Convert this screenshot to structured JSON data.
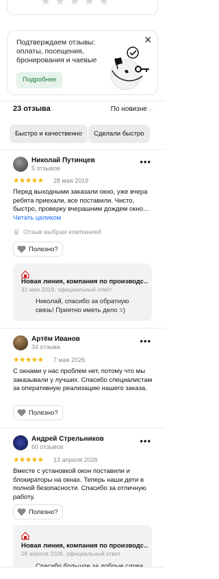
{
  "rating_filter": {
    "stars": [
      "★",
      "★",
      "★",
      "★",
      "★"
    ]
  },
  "promo": {
    "text": "Подтверждаем отзывы: оплаты, посещения, бронирования и чаевые",
    "button_label": "Подробнее",
    "close_icon": "✕"
  },
  "summary": {
    "count_label": "23 отзыва",
    "sort_label": "По новизне",
    "sort_arrow": "⌵"
  },
  "chips": [
    "Быстро и качественно",
    "Сделали быстро"
  ],
  "reviews": [
    {
      "author": "Николай Путинцев",
      "author_reviews": "5 отзывов",
      "stars": "★★★★★",
      "date": "28 мая 2019",
      "text": "Перед выходными заказали окно, уже вчера ребята приехали, все поставили. Чисто, быстро, проверку вчерашним дождем окно…",
      "read_more": "Читать целиком",
      "picked_label": "Отзыв выбран компанией",
      "useful_label": "Полезно?",
      "reply": {
        "company": "Новая линия, компания по производс…",
        "meta": "31 мая 2019, официальный ответ",
        "text": "Николай, спасибо за обратную связь! Приятно иметь дело =)"
      }
    },
    {
      "author": "Артём Иванов",
      "author_reviews": "34 отзыва",
      "stars": "★★★★★",
      "date": "7 мая 2026",
      "text": "С окнами у нас проблем нет, потому что мы заказывали у лучших. Спасибо специалистам за оперативную реализацию нашего заказа.",
      "useful_label": "Полезно?"
    },
    {
      "author": "Андрей Стрельников",
      "author_reviews": "60 отзывов",
      "stars": "★★★★★",
      "date": "13 апреля 2026",
      "text": "Вместе с установкой окон поставили и блокираторы на окнах. Теперь наши дети в полной безопасности. Спасибо за отличную работу.",
      "useful_label": "Полезно?",
      "reply": {
        "company": "Новая линия, компания по производс…",
        "meta": "28 апреля 2026, официальный ответ",
        "text": "Спасибо большое за добрые слова о"
      }
    }
  ],
  "colors": {
    "accent_green": "#1b7a3a",
    "star_yellow": "#f5b400",
    "link_blue": "#196dff"
  }
}
